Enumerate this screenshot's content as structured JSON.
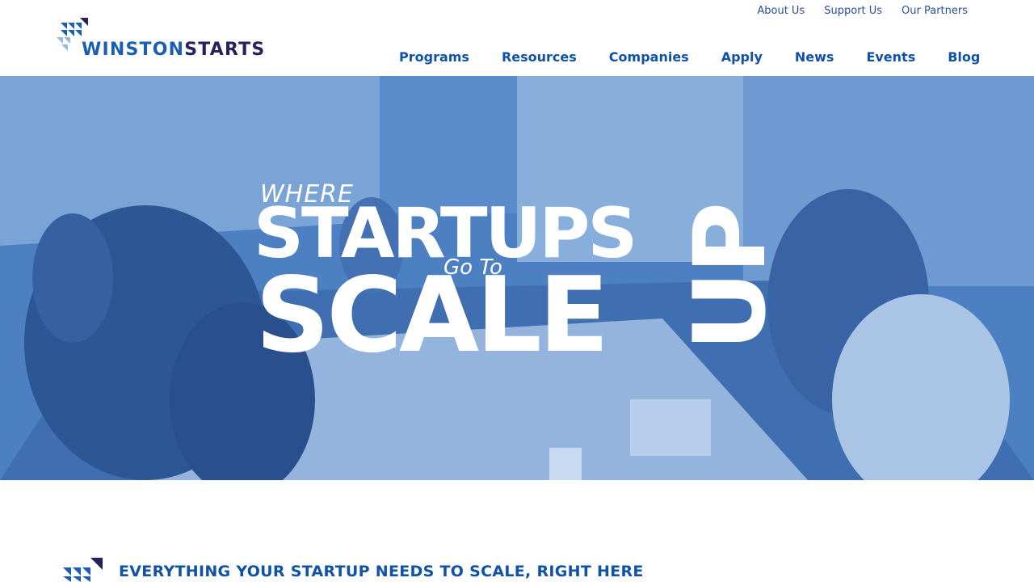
{
  "brand": {
    "name_part1": "WINSTON",
    "name_part2": "STARTS",
    "colors": {
      "primary_blue": "#1a5fb4",
      "dark_navy": "#26235c",
      "nav_blue": "#0f52a8",
      "hero_overlay": "#4d80c2"
    }
  },
  "utility_nav": [
    {
      "label": "About Us"
    },
    {
      "label": "Support Us"
    },
    {
      "label": "Our Partners"
    }
  ],
  "main_nav": [
    {
      "label": "Programs"
    },
    {
      "label": "Resources"
    },
    {
      "label": "Companies"
    },
    {
      "label": "Apply"
    },
    {
      "label": "News"
    },
    {
      "label": "Events"
    },
    {
      "label": "Blog"
    }
  ],
  "hero": {
    "line1": "WHERE",
    "line2": "STARTUPS",
    "line3": "Go To",
    "line4": "SCALE",
    "line5": "UP",
    "photo_icon": "meeting-room-photo"
  },
  "section": {
    "heading": "EVERYTHING YOUR STARTUP NEEDS TO SCALE, RIGHT HERE",
    "icon": "triangle-mosaic-icon"
  }
}
